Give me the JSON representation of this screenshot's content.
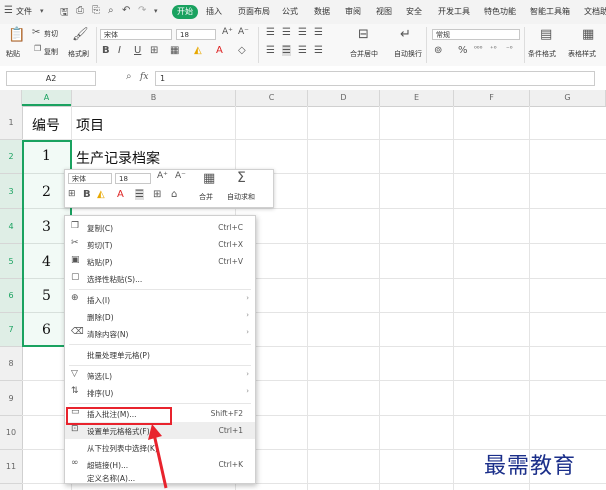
{
  "menubar": {
    "file": "文件",
    "start": "开始",
    "tabs": [
      "插入",
      "页面布局",
      "公式",
      "数据",
      "审阅",
      "视图",
      "安全",
      "开发工具",
      "特色功能",
      "智能工具箱",
      "文档助手"
    ]
  },
  "ribbon": {
    "paste": "粘贴",
    "cut": "剪切",
    "copy": "复制",
    "format_painter": "格式刷",
    "font_name": "宋体",
    "font_size": "18",
    "bold": "B",
    "italic": "I",
    "underline": "U",
    "merge_center": "合并居中",
    "wrap": "自动换行",
    "number_format": "常规",
    "percent": "%",
    "cond_format": "条件格式",
    "table_style": "表格样式"
  },
  "formulabar": {
    "name_box": "A2",
    "fx": "fx",
    "value": "1"
  },
  "columns": [
    "A",
    "B",
    "C",
    "D",
    "E",
    "F",
    "G"
  ],
  "rows": [
    "1",
    "2",
    "3",
    "4",
    "5",
    "6",
    "7",
    "8",
    "9",
    "10",
    "11"
  ],
  "cells": {
    "a1": "编号",
    "b1": "项目",
    "a2": "1",
    "b2": "生产记录档案",
    "a3": "2",
    "a4": "3",
    "a5": "4",
    "a6": "5",
    "a7": "6"
  },
  "minitoolbar": {
    "font_name": "宋体",
    "font_size": "18",
    "grow": "A⁺",
    "shrink": "A⁻",
    "bold": "B",
    "font_color": "A",
    "merge": "合并",
    "autosum": "自动求和"
  },
  "context_menu": {
    "copy": "复制(C)",
    "copy_sc": "Ctrl+C",
    "cut": "剪切(T)",
    "cut_sc": "Ctrl+X",
    "paste": "粘贴(P)",
    "paste_sc": "Ctrl+V",
    "paste_special": "选择性粘贴(S)...",
    "insert": "插入(I)",
    "delete": "删除(D)",
    "clear": "清除内容(N)",
    "batch": "批量处理单元格(P)",
    "filter": "筛选(L)",
    "sort": "排序(U)",
    "comment": "插入批注(M)...",
    "comment_sc": "Shift+F2",
    "format_cells": "设置单元格格式(F)...",
    "format_cells_sc": "Ctrl+1",
    "pick_list": "从下拉列表中选择(K)",
    "hyperlink": "超链接(H)...",
    "hyperlink_sc": "Ctrl+K",
    "define_name": "定义名称(A)..."
  },
  "watermark": "最需教育",
  "colors": {
    "accent": "#1aa260",
    "highlight": "#e8232d",
    "watermark": "#1b2f8a"
  }
}
